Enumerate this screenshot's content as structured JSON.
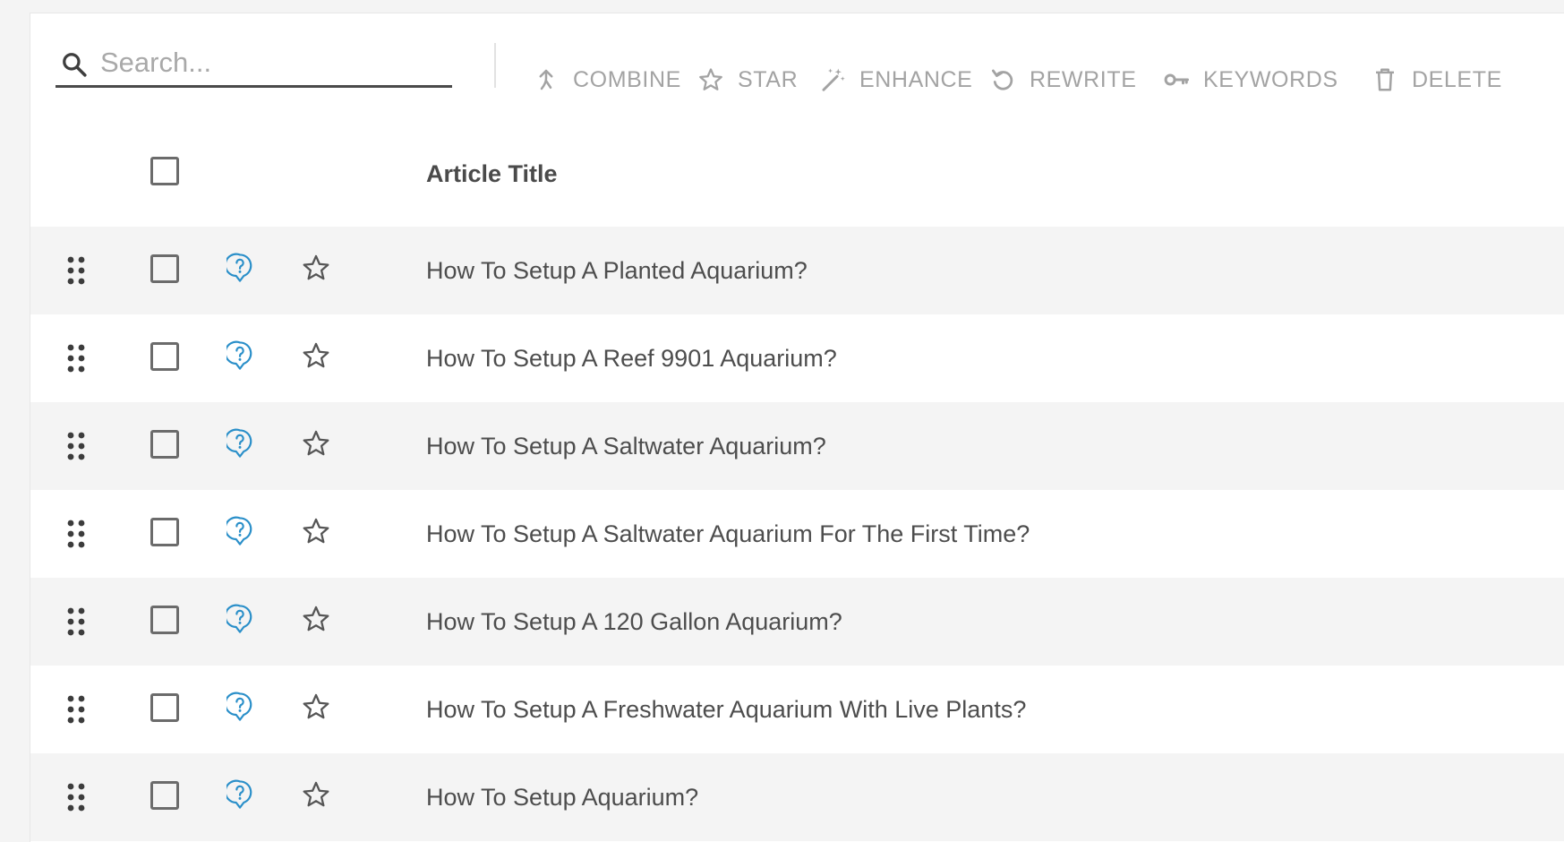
{
  "search": {
    "placeholder": "Search...",
    "value": ""
  },
  "toolbar": {
    "combine_label": "COMBINE",
    "star_label": "STAR",
    "enhance_label": "ENHANCE",
    "rewrite_label": "REWRITE",
    "keywords_label": "KEYWORDS",
    "delete_label": "DELETE"
  },
  "table": {
    "header_title": "Article Title",
    "rows": [
      {
        "title": "How To Setup A Planted Aquarium?"
      },
      {
        "title": "How To Setup A Reef 9901 Aquarium?"
      },
      {
        "title": "How To Setup A Saltwater Aquarium?"
      },
      {
        "title": "How To Setup A Saltwater Aquarium For The First Time?"
      },
      {
        "title": "How To Setup A 120 Gallon Aquarium?"
      },
      {
        "title": "How To Setup A Freshwater Aquarium With Live Plants?"
      },
      {
        "title": "How To Setup Aquarium?"
      }
    ]
  },
  "icons": {
    "search": "search-icon",
    "combine": "merge-icon",
    "star": "star-outline-icon",
    "enhance": "magic-wand-icon",
    "rewrite": "rotate-left-icon",
    "keywords": "key-icon",
    "delete": "trash-icon",
    "drag": "drag-handle-icon",
    "question": "question-bubble-icon"
  },
  "colors": {
    "toolbar_text": "#a3a3a3",
    "question_icon": "#2a8fc9",
    "row_alt_bg": "#f4f4f4"
  }
}
